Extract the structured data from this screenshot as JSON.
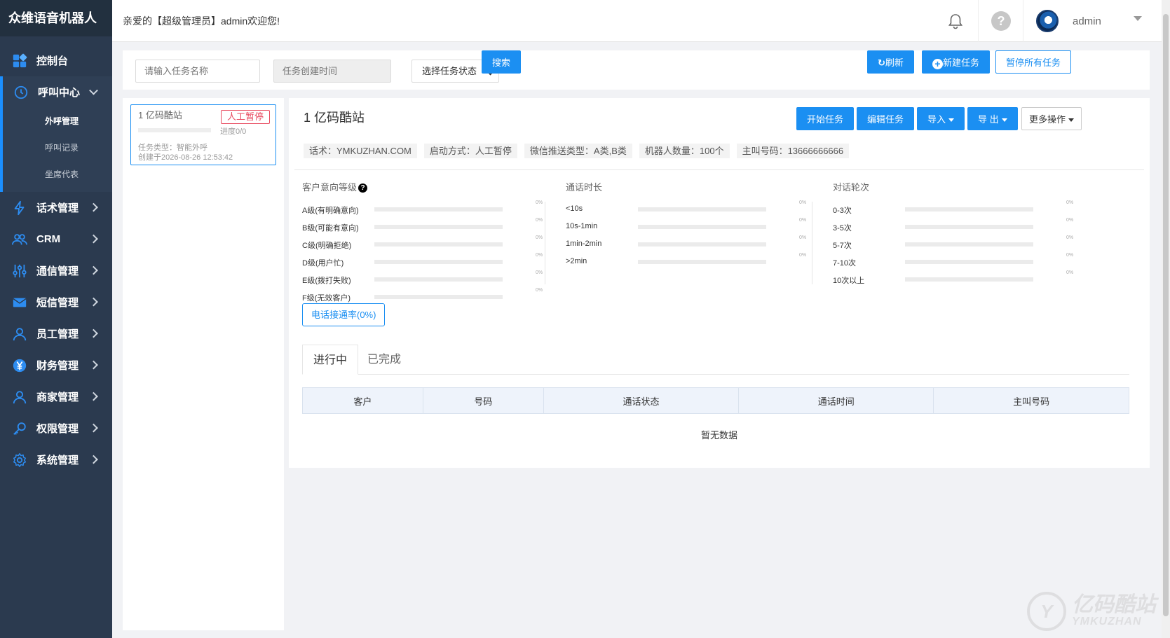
{
  "brand": "众维语音机器人",
  "header": {
    "welcome": "亲爱的【超级管理员】admin欢迎您!",
    "username": "admin"
  },
  "sidebar": {
    "items": [
      {
        "label": "控制台",
        "icon": "dashboard-icon"
      },
      {
        "label": "呼叫中心",
        "icon": "clock-icon"
      },
      {
        "label": "话术管理",
        "icon": "lightning-icon"
      },
      {
        "label": "CRM",
        "icon": "users-icon"
      },
      {
        "label": "通信管理",
        "icon": "sliders-icon"
      },
      {
        "label": "短信管理",
        "icon": "mail-icon"
      },
      {
        "label": "员工管理",
        "icon": "user-icon"
      },
      {
        "label": "财务管理",
        "icon": "yen-icon"
      },
      {
        "label": "商家管理",
        "icon": "user-icon"
      },
      {
        "label": "权限管理",
        "icon": "key-icon"
      },
      {
        "label": "系统管理",
        "icon": "gear-icon"
      }
    ],
    "subitems": [
      "外呼管理",
      "呼叫记录",
      "坐席代表"
    ]
  },
  "search": {
    "name_placeholder": "请输入任务名称",
    "time_placeholder": "任务创建时间",
    "status_select": "选择任务状态",
    "search_btn": "搜索",
    "refresh_btn": "刷新",
    "new_btn": "新建任务",
    "pause_all_btn": "暂停所有任务"
  },
  "task": {
    "name": "1 亿码酷站",
    "tag": "人工暂停",
    "progress_text": "进度0/0",
    "progress": 0,
    "type": "任务类型：智能外呼",
    "created": "创建于2026-08-26 12:53:42"
  },
  "detail": {
    "title": "1 亿码酷站",
    "actions": {
      "start": "开始任务",
      "edit": "编辑任务",
      "import": "导入",
      "export": "导 出",
      "more": "更多操作"
    },
    "chips": [
      "话术：YMKUZHAN.COM",
      "启动方式：人工暂停",
      "微信推送类型：A类,B类",
      "机器人数量：100个",
      "主叫号码：13666666666"
    ],
    "stats": {
      "intent": {
        "title": "客户意向等级",
        "rows": [
          {
            "label": "A级(有明确意向)",
            "pct": "0%",
            "value": 0
          },
          {
            "label": "B级(可能有意向)",
            "pct": "0%",
            "value": 0
          },
          {
            "label": "C级(明确拒绝)",
            "pct": "0%",
            "value": 0
          },
          {
            "label": "D级(用户忙)",
            "pct": "0%",
            "value": 0
          },
          {
            "label": "E级(拨打失败)",
            "pct": "0%",
            "value": 0
          },
          {
            "label": "F级(无效客户)",
            "pct": "0%",
            "value": 0
          }
        ]
      },
      "duration": {
        "title": "通话时长",
        "rows": [
          {
            "label": "<10s",
            "pct": "0%",
            "value": 0
          },
          {
            "label": "10s-1min",
            "pct": "0%",
            "value": 0
          },
          {
            "label": "1min-2min",
            "pct": "0%",
            "value": 0
          },
          {
            "label": ">2min",
            "pct": "0%",
            "value": 0
          }
        ]
      },
      "rounds": {
        "title": "对话轮次",
        "rows": [
          {
            "label": "0-3次",
            "pct": "0%",
            "value": 0
          },
          {
            "label": "3-5次",
            "pct": "0%",
            "value": 0
          },
          {
            "label": "5-7次",
            "pct": "0%",
            "value": 0
          },
          {
            "label": "7-10次",
            "pct": "0%",
            "value": 0
          },
          {
            "label": "10次以上",
            "pct": "0%",
            "value": 0
          }
        ]
      }
    },
    "connect_rate_btn": "电话接通率(0%)",
    "tabs": [
      "进行中",
      "已完成"
    ],
    "table_headers": [
      "客户",
      "号码",
      "通话状态",
      "通话时间",
      "主叫号码"
    ],
    "empty": "暂无数据"
  },
  "watermark": {
    "logo": "Y",
    "cn": "亿码酷站",
    "en": "YMKUZHAN"
  }
}
